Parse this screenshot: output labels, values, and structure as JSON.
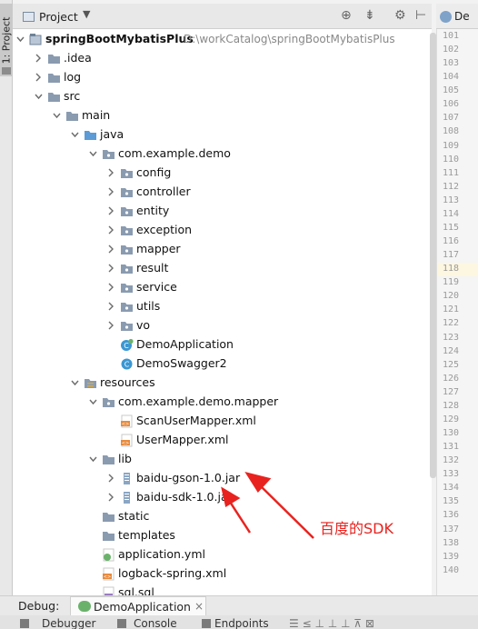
{
  "left_strip": {
    "tab_label": "1: Project"
  },
  "project_header": {
    "title": "Project",
    "dropdown_glyph": "▼"
  },
  "tree": [
    {
      "label": "springBootMybatisPlus",
      "path": "D:\\workCatalog\\springBootMybatisPlus",
      "depth": 0,
      "arrow": "open",
      "icon": "project-icon",
      "bold": true
    },
    {
      "label": ".idea",
      "depth": 1,
      "arrow": "closed",
      "icon": "folder-icon"
    },
    {
      "label": "log",
      "depth": 1,
      "arrow": "closed",
      "icon": "folder-icon"
    },
    {
      "label": "src",
      "depth": 1,
      "arrow": "open",
      "icon": "folder-icon"
    },
    {
      "label": "main",
      "depth": 2,
      "arrow": "open",
      "icon": "folder-icon"
    },
    {
      "label": "java",
      "depth": 3,
      "arrow": "open",
      "icon": "source-folder-icon"
    },
    {
      "label": "com.example.demo",
      "depth": 4,
      "arrow": "open",
      "icon": "package-icon"
    },
    {
      "label": "config",
      "depth": 5,
      "arrow": "closed",
      "icon": "package-icon"
    },
    {
      "label": "controller",
      "depth": 5,
      "arrow": "closed",
      "icon": "package-icon"
    },
    {
      "label": "entity",
      "depth": 5,
      "arrow": "closed",
      "icon": "package-icon"
    },
    {
      "label": "exception",
      "depth": 5,
      "arrow": "closed",
      "icon": "package-icon"
    },
    {
      "label": "mapper",
      "depth": 5,
      "arrow": "closed",
      "icon": "package-icon"
    },
    {
      "label": "result",
      "depth": 5,
      "arrow": "closed",
      "icon": "package-icon"
    },
    {
      "label": "service",
      "depth": 5,
      "arrow": "closed",
      "icon": "package-icon"
    },
    {
      "label": "utils",
      "depth": 5,
      "arrow": "closed",
      "icon": "package-icon"
    },
    {
      "label": "vo",
      "depth": 5,
      "arrow": "closed",
      "icon": "package-icon"
    },
    {
      "label": "DemoApplication",
      "depth": 5,
      "arrow": "none",
      "icon": "spring-class-icon"
    },
    {
      "label": "DemoSwagger2",
      "depth": 5,
      "arrow": "none",
      "icon": "class-icon"
    },
    {
      "label": "resources",
      "depth": 3,
      "arrow": "open",
      "icon": "resources-folder-icon"
    },
    {
      "label": "com.example.demo.mapper",
      "depth": 4,
      "arrow": "open",
      "icon": "package-icon"
    },
    {
      "label": "ScanUserMapper.xml",
      "depth": 5,
      "arrow": "none",
      "icon": "xml-file-icon"
    },
    {
      "label": "UserMapper.xml",
      "depth": 5,
      "arrow": "none",
      "icon": "xml-file-icon"
    },
    {
      "label": "lib",
      "depth": 4,
      "arrow": "open",
      "icon": "folder-icon"
    },
    {
      "label": "baidu-gson-1.0.jar",
      "depth": 5,
      "arrow": "closed",
      "icon": "jar-icon"
    },
    {
      "label": "baidu-sdk-1.0.jar",
      "depth": 5,
      "arrow": "closed",
      "icon": "jar-icon"
    },
    {
      "label": "static",
      "depth": 4,
      "arrow": "none",
      "icon": "folder-icon"
    },
    {
      "label": "templates",
      "depth": 4,
      "arrow": "none",
      "icon": "folder-icon"
    },
    {
      "label": "application.yml",
      "depth": 4,
      "arrow": "none",
      "icon": "yml-file-icon"
    },
    {
      "label": "logback-spring.xml",
      "depth": 4,
      "arrow": "none",
      "icon": "xml-file-icon"
    },
    {
      "label": "sql.sql",
      "depth": 4,
      "arrow": "none",
      "icon": "sql-file-icon"
    }
  ],
  "editor": {
    "tab_label": "De",
    "line_numbers": [
      "101",
      "102",
      "103",
      "104",
      "105",
      "106",
      "107",
      "108",
      "109",
      "110",
      "111",
      "112",
      "113",
      "114",
      "115",
      "116",
      "117",
      "118",
      "119",
      "120",
      "121",
      "122",
      "123",
      "124",
      "125",
      "126",
      "127",
      "128",
      "129",
      "130",
      "131",
      "132",
      "133",
      "134",
      "135",
      "136",
      "137",
      "138",
      "139",
      "140"
    ],
    "highlighted_line": "118"
  },
  "annotation": {
    "text": "百度的SDK",
    "color": "#e8231f"
  },
  "debug_bar": {
    "label": "Debug:",
    "tab_label": "DemoApplication",
    "close_glyph": "×"
  },
  "bottom_toolbar": {
    "tabs": [
      "Debugger",
      "Console",
      "Endpoints"
    ]
  },
  "colors": {
    "folder": "#8a9bb0",
    "source_folder": "#5c9bd6",
    "package": "#8a9bb0",
    "jar": "#8aa6c4",
    "xml": "#e98a3c",
    "spring": "#6ab26b",
    "class": "#3b97d3"
  }
}
